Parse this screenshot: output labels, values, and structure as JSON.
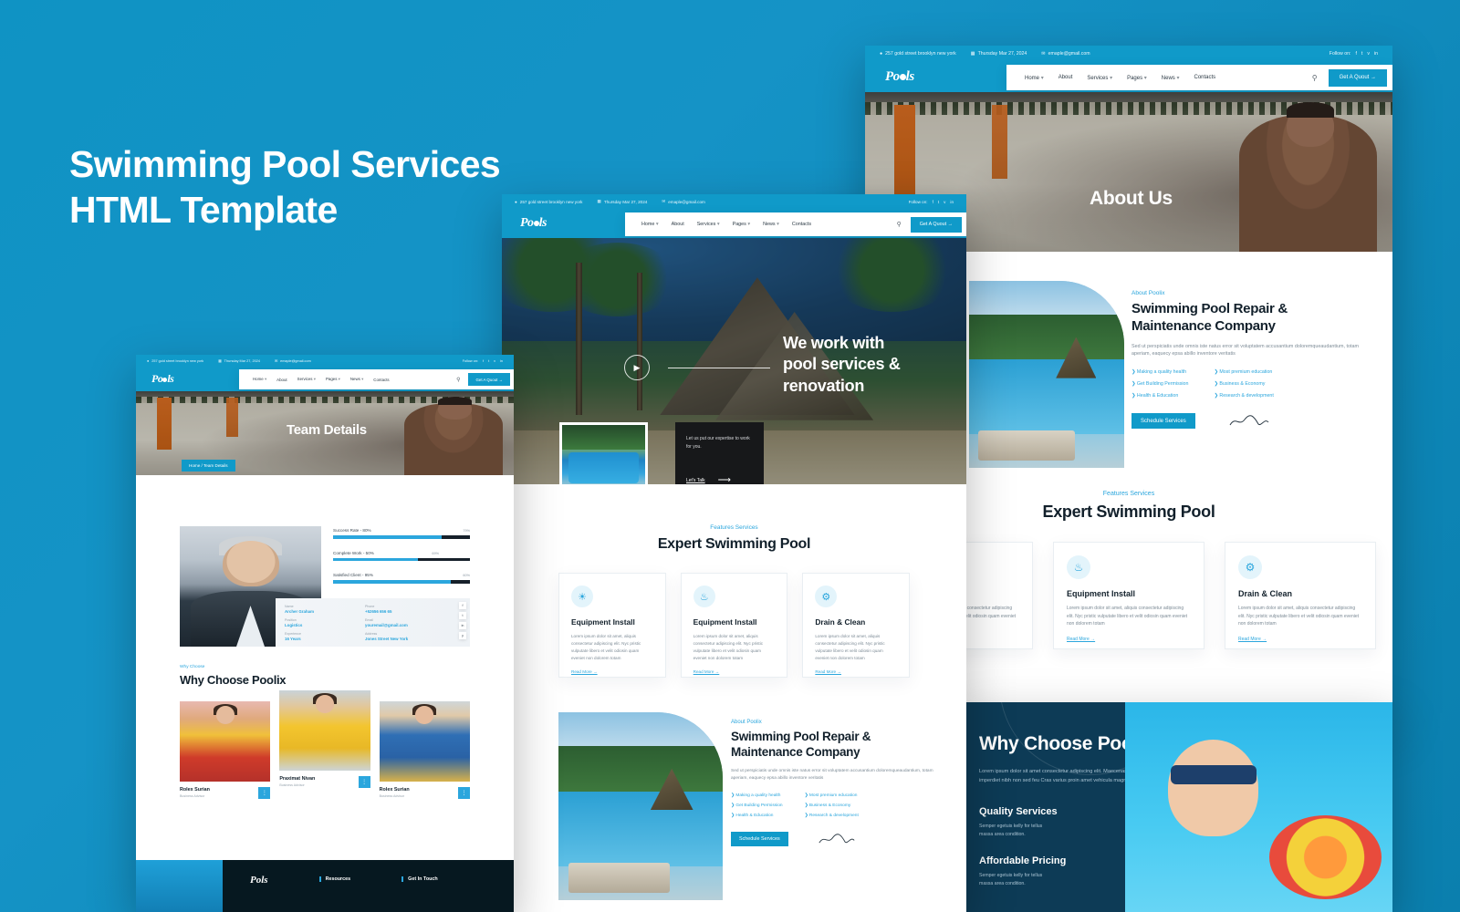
{
  "promo": {
    "line1": "Swimming Pool Services",
    "line2": "HTML Template"
  },
  "brand": {
    "pre": "Po",
    "post": "ls"
  },
  "topbar": {
    "address": "257 gold street brooklyn new york",
    "date": "Thursday Mar 27, 2024",
    "email": "emaple@gmail.com",
    "follow_label": "Follow on:",
    "social": [
      "f",
      "t",
      "v",
      "in"
    ]
  },
  "nav": {
    "items": [
      {
        "label": "Home",
        "caret": true
      },
      {
        "label": "About",
        "caret": false
      },
      {
        "label": "Services",
        "caret": true
      },
      {
        "label": "Pages",
        "caret": true
      },
      {
        "label": "News",
        "caret": true
      },
      {
        "label": "Contacts",
        "caret": false
      }
    ],
    "search_icon": "search-icon",
    "quote_button": "Get A Quout →"
  },
  "about_page": {
    "hero_title": "About Us"
  },
  "team_page": {
    "hero_title": "Team Details",
    "breadcrumb": "Home / Team Details",
    "progress": [
      {
        "label": "Success Rate - 80%",
        "pct_text": "79%",
        "value": 79
      },
      {
        "label": "Complete Work - 50%",
        "pct_text": "69%",
        "value": 62
      },
      {
        "label": "Satisfied Client - 95%",
        "pct_text": "60%",
        "value": 86
      }
    ],
    "info": [
      {
        "key": "Name",
        "value": "Archer Graham"
      },
      {
        "key": "Phone",
        "value": "+52656 656 65"
      },
      {
        "key": "Position",
        "value": "Logistics"
      },
      {
        "key": "Email",
        "value": "youremail@gmail.com"
      },
      {
        "key": "Experience",
        "value": "16 Years"
      },
      {
        "key": "Address",
        "value": "Jones Street New York"
      }
    ],
    "social_chips": [
      "f",
      "t",
      "in",
      "y"
    ],
    "why": {
      "eyebrow": "Why Choose",
      "title": "Why Choose Poolix"
    },
    "members": [
      {
        "name": "Rolex Surian",
        "role": "Business Advisor"
      },
      {
        "name": "Praximat Nivan",
        "role": "Business Advisor"
      },
      {
        "name": "Rolex Surian",
        "role": "Business Advisor"
      }
    ]
  },
  "home_page": {
    "hero": {
      "title_line1": "We work with",
      "title_line2": "pool services &",
      "title_line3": "renovation",
      "play_icon": "play-icon",
      "card_text": "Let us put our expertise to work for you.",
      "card_link": "Let's Talk",
      "card_arrow": "arrow-right-icon"
    }
  },
  "features": {
    "eyebrow": "Features Services",
    "title": "Expert Swimming Pool",
    "read_more": "Read More →",
    "cards": [
      {
        "icon": "globe-pool-icon",
        "title": "Equipment Install",
        "desc": "Lorem ipsum dolor sit amet, aliquis consectetur adipiscing elit. Nyc pristic vulputate libero et velit odiosin quam eveniet non dolorem totam"
      },
      {
        "icon": "pool-cleaner-icon",
        "title": "Equipment Install",
        "desc": "Lorem ipsum dolor sit amet, aliquis consectetur adipiscing elit. Nyc pristic vulputate libero et velit odiosin quam eveniet non dolorem totam"
      },
      {
        "icon": "drain-clean-icon",
        "title": "Drain & Clean",
        "desc": "Lorem ipsum dolor sit amet, aliquis consectetur adipiscing elit. Nyc pristic vulputate libero et velit odiosin quam eveniet non dolorem totam"
      }
    ]
  },
  "about_block": {
    "eyebrow": "About Poolix",
    "title_line1": "Swimming Pool Repair &",
    "title_line2": "Maintenance Company",
    "desc": "Sed ut perspiciatis unde omnis iste natus error sit voluptatem accusantium doloremqueaudantium, totam aperiam, eaquecy epsa abillo inventore veritatis",
    "checklist_left": [
      "Making a quality health",
      "Get Building Permission",
      "Health & Education"
    ],
    "checklist_right": [
      "Most premium education",
      "Business & Economy",
      "Research & development"
    ],
    "button": "Schedule Services",
    "signature": "Signature"
  },
  "dark_why": {
    "title": "Why Choose Poolix",
    "desc_line1": "Lorem ipsum dolor sit amet consectetur adipiscing elit. Maecenas turpis",
    "desc_line2": "imperdiet nibh non sed feu Cras varius proin amet vehicula magna...",
    "items": [
      {
        "title": "Quality Services",
        "line1": "Semper egetuis kelly for tellus",
        "line2": "massa area condition."
      },
      {
        "title": "Affordable Pricing",
        "line1": "Semper egetuis kelly for tellus",
        "line2": "massa area condition."
      }
    ]
  },
  "footer": {
    "columns": [
      "Resources",
      "Get In Touch"
    ]
  },
  "colors": {
    "brand_blue": "#109ac9",
    "accent": "#2ba6dd",
    "dark": "#0d3b56",
    "footer": "#061820",
    "ink": "#12202b"
  }
}
